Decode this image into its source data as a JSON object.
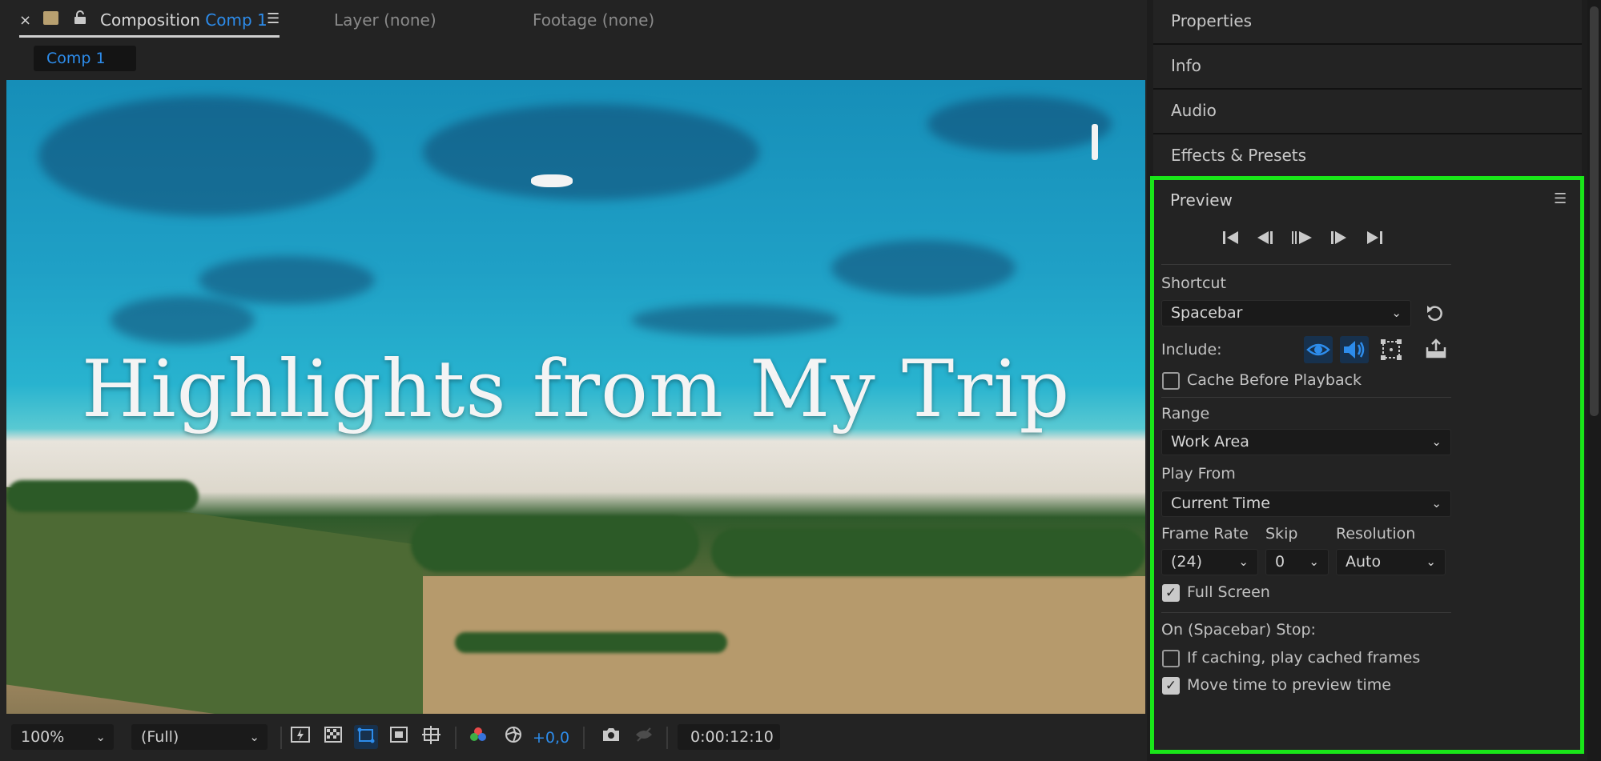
{
  "tabs": {
    "close": "×",
    "composition_label": "Composition",
    "composition_name": "Comp 1",
    "menu": "☰",
    "layer": "Layer (none)",
    "footage": "Footage (none)",
    "comp_chip": "Comp 1"
  },
  "viewer": {
    "title_overlay": "Highlights from My Trip"
  },
  "bottom_toolbar": {
    "zoom": "100%",
    "resolution": "(Full)",
    "exposure": "+0,0",
    "timecode": "0:00:12:10"
  },
  "right_panels": {
    "properties": "Properties",
    "info": "Info",
    "audio": "Audio",
    "effects": "Effects & Presets"
  },
  "preview": {
    "title": "Preview",
    "menu": "☰",
    "shortcut_label": "Shortcut",
    "shortcut_value": "Spacebar",
    "include_label": "Include:",
    "cache_before_playback": "Cache Before Playback",
    "range_label": "Range",
    "range_value": "Work Area",
    "play_from_label": "Play From",
    "play_from_value": "Current Time",
    "frame_rate_label": "Frame Rate",
    "frame_rate_value": "(24)",
    "skip_label": "Skip",
    "skip_value": "0",
    "resolution_label": "Resolution",
    "resolution_value": "Auto",
    "full_screen": "Full Screen",
    "on_stop_label": "On (Spacebar) Stop:",
    "if_caching": "If caching, play cached frames",
    "move_time": "Move time to preview time"
  },
  "icons": {
    "chevron": "⌄",
    "check": "✓"
  },
  "colors": {
    "accent_blue": "#2d8ceb",
    "highlight_green": "#19e619"
  }
}
